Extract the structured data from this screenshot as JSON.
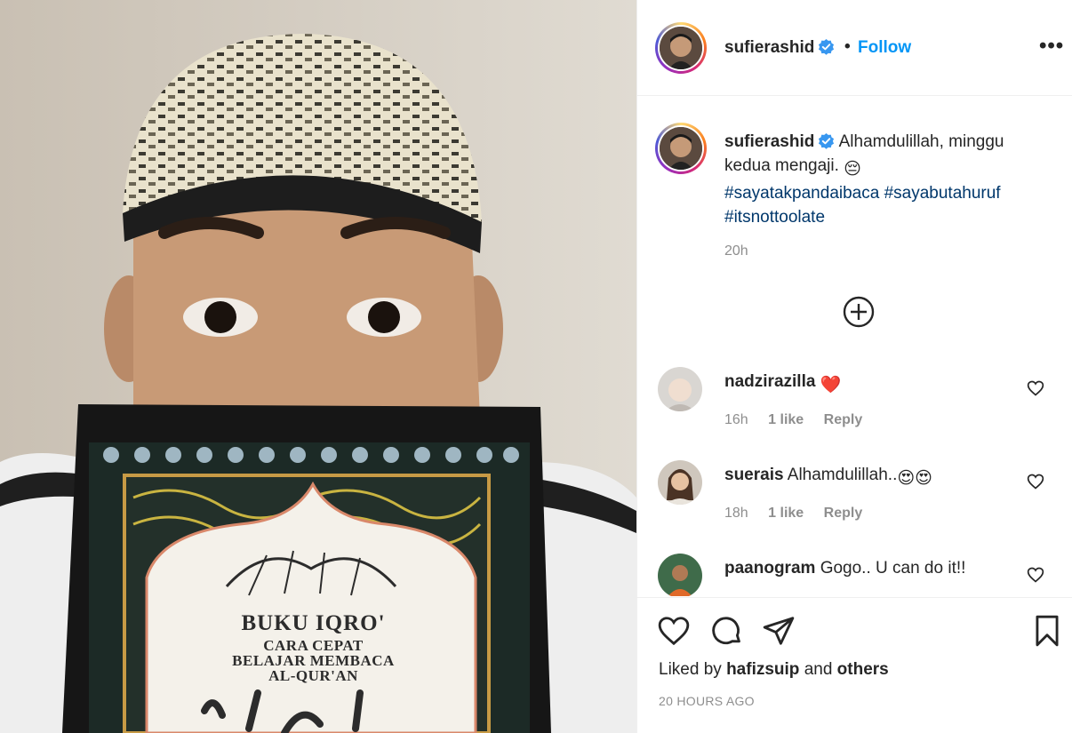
{
  "post": {
    "author": "sufierashid",
    "follow_label": "Follow",
    "bullet": "•",
    "more_label": "•••",
    "caption_text": "Alhamdulillah, minggu kedua mengaji.",
    "caption_emoji": "😔",
    "hashtags": [
      "#sayatakpandaibaca",
      "#sayabutahuruf",
      "#itsnottoolate"
    ],
    "caption_time": "20h",
    "book": {
      "title": "BUKU IQRO'",
      "subtitle_lines": [
        "CARA CEPAT",
        "BELAJAR MEMBACA",
        "AL-QUR'AN"
      ]
    }
  },
  "comments": [
    {
      "username": "nadzirazilla",
      "text": "",
      "emoji": "❤️",
      "time": "16h",
      "likes": "1 like",
      "reply": "Reply"
    },
    {
      "username": "suerais",
      "text": "Alhamdulillah..",
      "emoji": "😍😍",
      "time": "18h",
      "likes": "1 like",
      "reply": "Reply"
    },
    {
      "username": "paanogram",
      "text": "Gogo.. U can do it!!",
      "emoji": "",
      "time": "",
      "likes": "",
      "reply": ""
    }
  ],
  "footer": {
    "liked_prefix": "Liked by",
    "liked_user": "hafizsuip",
    "liked_and": "and",
    "liked_others": "others",
    "posted_ago": "20 HOURS AGO"
  },
  "colors": {
    "accent": "#0095f6",
    "hashtag": "#00376b",
    "muted": "#8e8e8e",
    "verified": "#3897f0"
  }
}
